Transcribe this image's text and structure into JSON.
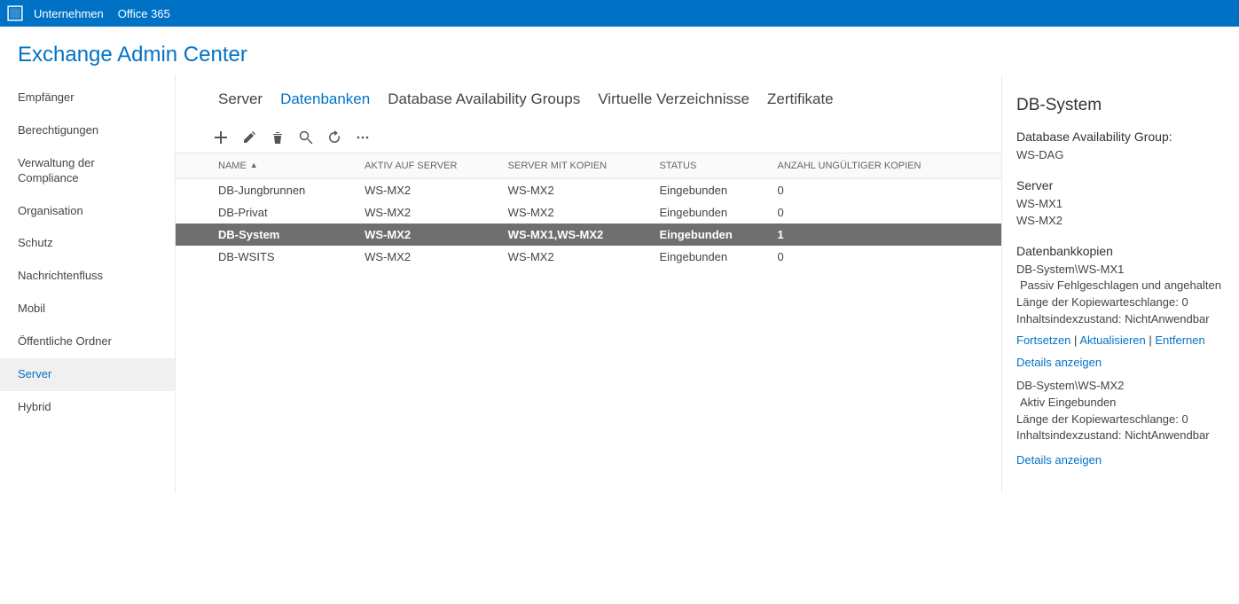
{
  "topbar": {
    "company": "Unternehmen",
    "office": "Office 365"
  },
  "page_title": "Exchange Admin Center",
  "sidebar": {
    "items": [
      {
        "label": "Empfänger"
      },
      {
        "label": "Berechtigungen"
      },
      {
        "label": "Verwaltung der Compliance"
      },
      {
        "label": "Organisation"
      },
      {
        "label": "Schutz"
      },
      {
        "label": "Nachrichtenfluss"
      },
      {
        "label": "Mobil"
      },
      {
        "label": "Öffentliche Ordner"
      },
      {
        "label": "Server"
      },
      {
        "label": "Hybrid"
      }
    ],
    "active_index": 8
  },
  "subtabs": {
    "items": [
      "Server",
      "Datenbanken",
      "Database Availability Groups",
      "Virtuelle Verzeichnisse",
      "Zertifikate"
    ],
    "active_index": 1
  },
  "table": {
    "columns": [
      "NAME",
      "AKTIV AUF SERVER",
      "SERVER MIT KOPIEN",
      "STATUS",
      "ANZAHL UNGÜLTIGER KOPIEN"
    ],
    "sorted_col": 0,
    "sort_dir": "asc",
    "rows": [
      {
        "cells": [
          "DB-Jungbrunnen",
          "WS-MX2",
          "WS-MX2",
          "Eingebunden",
          "0"
        ]
      },
      {
        "cells": [
          "DB-Privat",
          "WS-MX2",
          "WS-MX2",
          "Eingebunden",
          "0"
        ]
      },
      {
        "cells": [
          "DB-System",
          "WS-MX2",
          "WS-MX1,WS-MX2",
          "Eingebunden",
          "1"
        ]
      },
      {
        "cells": [
          "DB-WSITS",
          "WS-MX2",
          "WS-MX2",
          "Eingebunden",
          "0"
        ]
      }
    ],
    "selected_index": 2
  },
  "details": {
    "title": "DB-System",
    "dag_label": "Database Availability Group:",
    "dag_value": "WS-DAG",
    "server_label": "Server",
    "servers": [
      "WS-MX1",
      "WS-MX2"
    ],
    "copies_label": "Datenbankkopien",
    "copies": [
      {
        "name": "DB-System\\WS-MX1",
        "status": "Passiv Fehlgeschlagen und angehalten",
        "queue": "Länge der Kopiewarteschlange:  0",
        "index": "Inhaltsindexzustand:  NichtAnwendbar",
        "links": [
          "Fortsetzen",
          "Aktualisieren",
          "Entfernen"
        ],
        "details": "Details anzeigen"
      },
      {
        "name": "DB-System\\WS-MX2",
        "status": "Aktiv Eingebunden",
        "queue": "Länge der Kopiewarteschlange:  0",
        "index": "Inhaltsindexzustand:  NichtAnwendbar",
        "links": [],
        "details": "Details anzeigen"
      }
    ]
  }
}
